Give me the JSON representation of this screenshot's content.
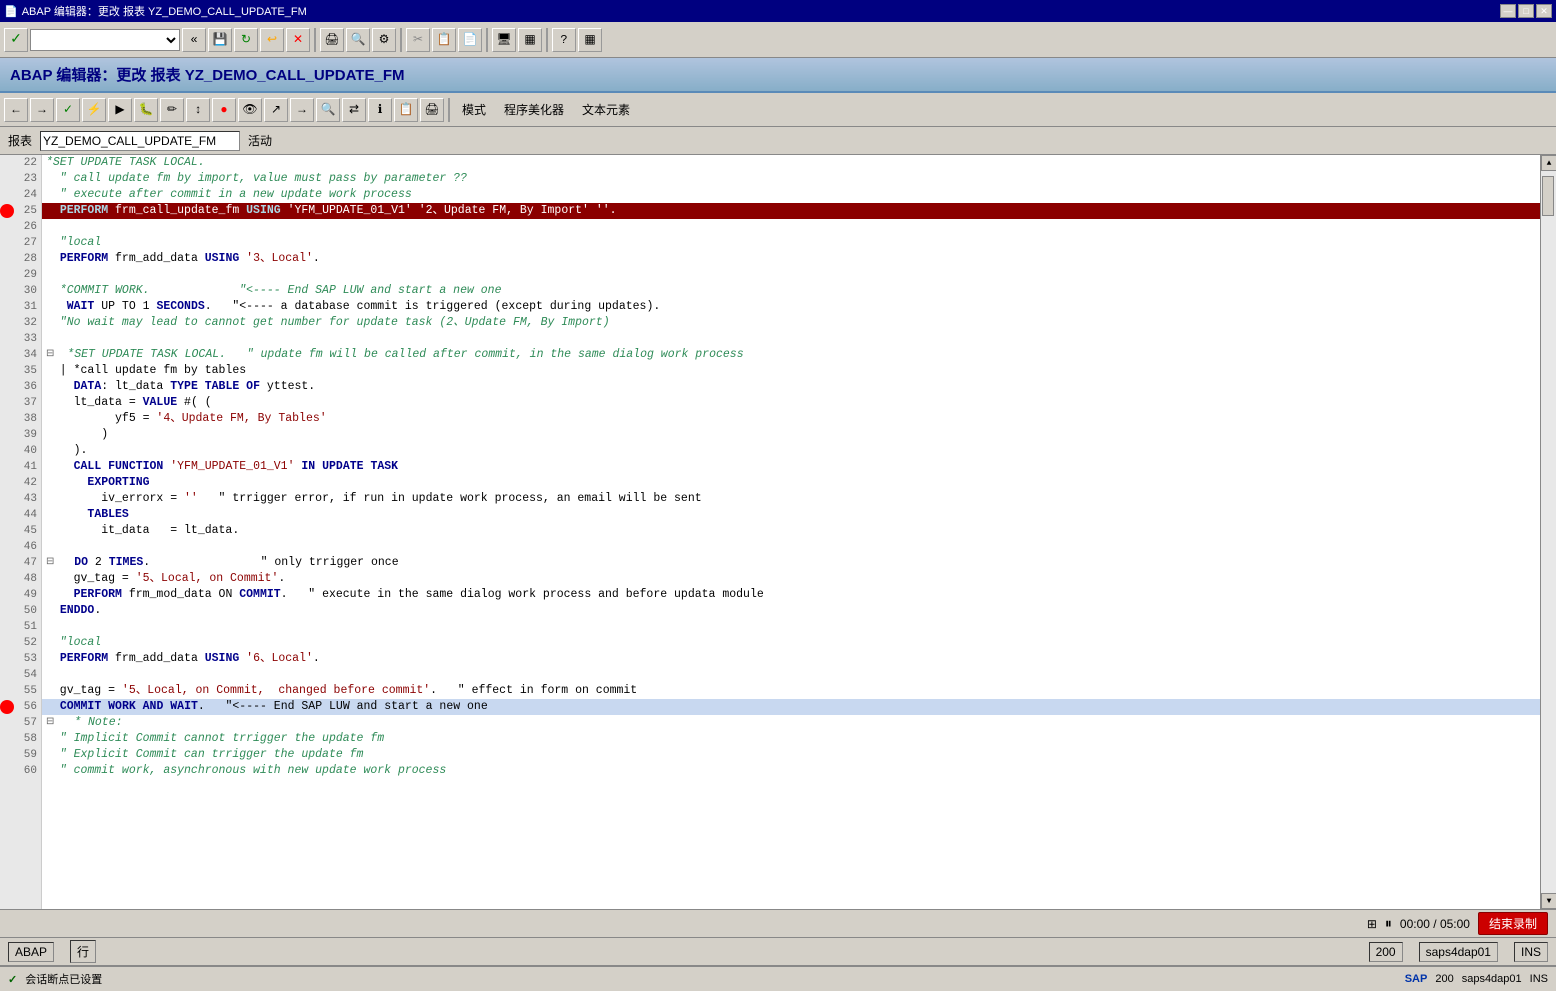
{
  "title": {
    "icon": "📄",
    "text": "ABAP 编辑器：更改 报表 YZ_DEMO_CALL_UPDATE_FM",
    "min": "—",
    "max": "□",
    "close": "✕"
  },
  "abap_header": "ABAP 编辑器：更改 报表 YZ_DEMO_CALL_UPDATE_FM",
  "report_bar": {
    "label": "报表",
    "value": "YZ_DEMO_CALL_UPDATE_FM",
    "status": "活动"
  },
  "menu": {
    "items": [
      "模式",
      "程序美化器",
      "文本元素"
    ]
  },
  "bottom_status": {
    "lang": "ABAP",
    "row_label": "行",
    "timer": "00:00 / 05:00",
    "end_btn": "结束录制",
    "zoom": "200",
    "server": "saps4dap01",
    "mode": "INS"
  },
  "very_bottom": {
    "checkpoint_icon": "✓",
    "checkpoint_text": "会话断点已设置",
    "sap_logo": "SAP",
    "zoom_text": "200",
    "server_text": "saps4dap01",
    "mode_text": "INS"
  },
  "lines": [
    {
      "num": 22,
      "bp": false,
      "fold": false,
      "text": "*SET UPDATE TASK LOCAL.",
      "type": "comment"
    },
    {
      "num": 23,
      "bp": false,
      "fold": false,
      "text": "  \" call update fm by import, value must pass by parameter ??",
      "type": "comment"
    },
    {
      "num": 24,
      "bp": false,
      "fold": false,
      "text": "  \" execute after commit in a new update work process",
      "type": "comment"
    },
    {
      "num": 25,
      "bp": true,
      "fold": false,
      "text": "  PERFORM frm_call_update_fm USING 'YFM_UPDATE_01_V1' '2、Update FM, By Import' ''.",
      "type": "highlighted"
    },
    {
      "num": 26,
      "bp": false,
      "fold": false,
      "text": "",
      "type": "normal"
    },
    {
      "num": 27,
      "bp": false,
      "fold": false,
      "text": "  \"local",
      "type": "comment"
    },
    {
      "num": 28,
      "bp": false,
      "fold": false,
      "text": "  PERFORM frm_add_data USING '3、Local'.",
      "type": "normal"
    },
    {
      "num": 29,
      "bp": false,
      "fold": false,
      "text": "",
      "type": "normal"
    },
    {
      "num": 30,
      "bp": false,
      "fold": false,
      "text": "  *COMMIT WORK.             \"<---- End SAP LUW and start a new one",
      "type": "comment"
    },
    {
      "num": 31,
      "bp": false,
      "fold": false,
      "text": "   WAIT UP TO 1 SECONDS.   \"<---- a database commit is triggered (except during updates).",
      "type": "normal_wait"
    },
    {
      "num": 32,
      "bp": false,
      "fold": false,
      "text": "  \"No wait may lead to cannot get number for update task (2、Update FM, By Import)",
      "type": "comment"
    },
    {
      "num": 33,
      "bp": false,
      "fold": false,
      "text": "",
      "type": "normal"
    },
    {
      "num": 34,
      "bp": false,
      "fold": true,
      "text": " *SET UPDATE TASK LOCAL.   \" update fm will be called after commit, in the same dialog work process",
      "type": "comment"
    },
    {
      "num": 35,
      "bp": false,
      "fold": false,
      "text": "  | *call update fm by tables",
      "type": "comment"
    },
    {
      "num": 36,
      "bp": false,
      "fold": false,
      "text": "    DATA: lt_data TYPE TABLE OF yttest.",
      "type": "normal"
    },
    {
      "num": 37,
      "bp": false,
      "fold": false,
      "text": "    lt_data = VALUE #( (",
      "type": "normal"
    },
    {
      "num": 38,
      "bp": false,
      "fold": false,
      "text": "          yf5 = '4、Update FM, By Tables'",
      "type": "normal"
    },
    {
      "num": 39,
      "bp": false,
      "fold": false,
      "text": "        )",
      "type": "normal"
    },
    {
      "num": 40,
      "bp": false,
      "fold": false,
      "text": "    ).",
      "type": "normal"
    },
    {
      "num": 41,
      "bp": false,
      "fold": false,
      "text": "    CALL FUNCTION 'YFM_UPDATE_01_V1' IN UPDATE TASK",
      "type": "normal"
    },
    {
      "num": 42,
      "bp": false,
      "fold": false,
      "text": "      EXPORTING",
      "type": "normal"
    },
    {
      "num": 43,
      "bp": false,
      "fold": false,
      "text": "        iv_errorx = ''   \" trrigger error, if run in update work process, an email will be sent",
      "type": "normal"
    },
    {
      "num": 44,
      "bp": false,
      "fold": false,
      "text": "      TABLES",
      "type": "normal"
    },
    {
      "num": 45,
      "bp": false,
      "fold": false,
      "text": "        it_data   = lt_data.",
      "type": "normal"
    },
    {
      "num": 46,
      "bp": false,
      "fold": false,
      "text": "",
      "type": "normal"
    },
    {
      "num": 47,
      "bp": false,
      "fold": true,
      "text": "  DO 2 TIMES.                \" only trrigger once",
      "type": "normal"
    },
    {
      "num": 48,
      "bp": false,
      "fold": false,
      "text": "    gv_tag = '5、Local, on Commit'.",
      "type": "normal"
    },
    {
      "num": 49,
      "bp": false,
      "fold": false,
      "text": "    PERFORM frm_mod_data ON COMMIT.   \" execute in the same dialog work process and before updata module",
      "type": "normal"
    },
    {
      "num": 50,
      "bp": false,
      "fold": false,
      "text": "  ENDDO.",
      "type": "normal"
    },
    {
      "num": 51,
      "bp": false,
      "fold": false,
      "text": "",
      "type": "normal"
    },
    {
      "num": 52,
      "bp": false,
      "fold": false,
      "text": "  \"local",
      "type": "comment"
    },
    {
      "num": 53,
      "bp": false,
      "fold": false,
      "text": "  PERFORM frm_add_data USING '6、Local'.",
      "type": "normal"
    },
    {
      "num": 54,
      "bp": false,
      "fold": false,
      "text": "",
      "type": "normal"
    },
    {
      "num": 55,
      "bp": false,
      "fold": false,
      "text": "  gv_tag = '5、Local, on Commit,  changed before commit'.   \" effect in form on commit",
      "type": "normal"
    },
    {
      "num": 56,
      "bp": true,
      "fold": false,
      "text": "  COMMIT WORK AND WAIT.   \"<---- End SAP LUW and start a new one",
      "type": "light-highlight"
    },
    {
      "num": 57,
      "bp": false,
      "fold": true,
      "text": "  * Note:",
      "type": "comment"
    },
    {
      "num": 58,
      "bp": false,
      "fold": false,
      "text": "  \" Implicit Commit cannot trrigger the update fm",
      "type": "comment"
    },
    {
      "num": 59,
      "bp": false,
      "fold": false,
      "text": "  \" Explicit Commit can trrigger the update fm",
      "type": "comment"
    },
    {
      "num": 60,
      "bp": false,
      "fold": false,
      "text": "  \" commit work, asynchronous with new update work process",
      "type": "comment"
    }
  ]
}
